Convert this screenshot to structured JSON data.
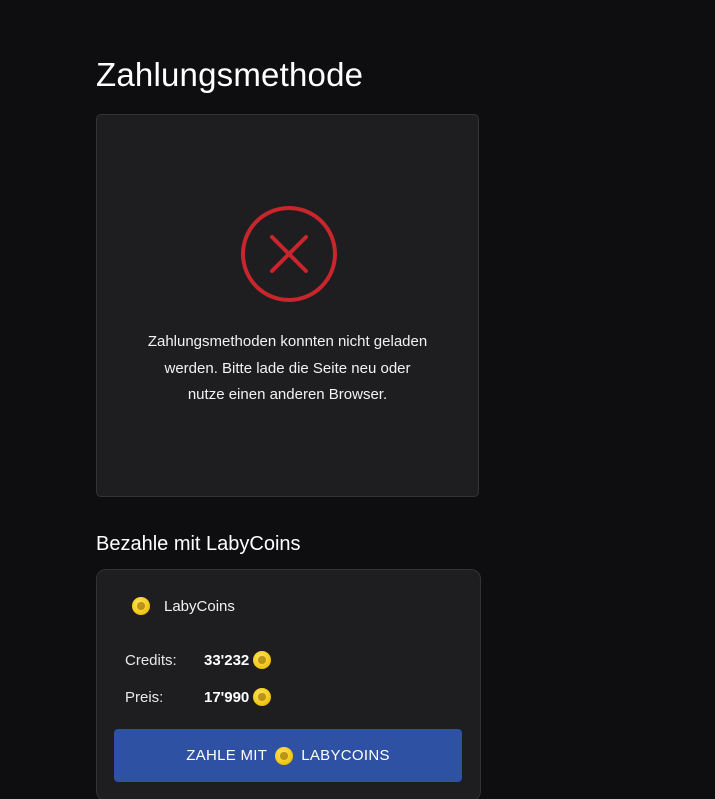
{
  "page": {
    "title": "Zahlungsmethode"
  },
  "error": {
    "icon": "error-x-circle-icon",
    "icon_color": "#c8262c",
    "message_lines": [
      "Zahlungsmethoden konnten nicht geladen",
      "werden. Bitte lade die Seite neu oder",
      "nutze einen anderen Browser."
    ]
  },
  "labycoins": {
    "section_title": "Bezahle mit LabyCoins",
    "method_label": "LabyCoins",
    "coin_icon": "labycoin-icon",
    "coin_color": "#f4cc1d",
    "credits_label": "Credits:",
    "credits_value": "33'232",
    "price_label": "Preis:",
    "price_value": "17'990",
    "button_text_before": "ZAHLE MIT",
    "button_text_after": "LABYCOINS",
    "button_color": "#2f51a3"
  }
}
